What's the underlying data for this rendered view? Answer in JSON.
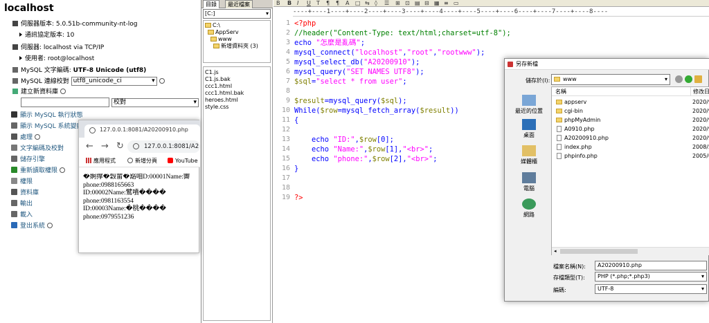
{
  "pma": {
    "host": "localhost",
    "server_version": "伺服器版本: 5.0.51b-community-nt-log",
    "protocol": "通訊協定版本: 10",
    "server": "伺服器: localhost via TCP/IP",
    "user": "使用者: root@localhost",
    "charset_label": "MySQL 文字編碼:",
    "charset_value": "UTF-8 Unicode (utf8)",
    "collation_label": "MySQL 連線校對",
    "collation_value": "utf8_unicode_ci",
    "create_db": "建立新資料庫",
    "collation_select": "校對",
    "menu": [
      "顯示 MySQL 執行狀態",
      "顯示 MySQL 系統變數",
      "處理",
      "文字編碼及校對",
      "儲存引擎",
      "重新讀取權限",
      "權限",
      "資料庫",
      "輸出",
      "載入",
      "登出系統"
    ]
  },
  "filebrowser": {
    "tabs": [
      "目錄",
      "最近檔案"
    ],
    "drive": "[C:]",
    "tree": [
      "C:\\",
      "AppServ",
      "www",
      "新增資料夾 (3)"
    ],
    "files": [
      "C1.js",
      "C1.js.bak",
      "ccc1.html",
      "ccc1.html.bak",
      "heroes.html",
      "style.css"
    ]
  },
  "editor": {
    "toolbar": [
      "B",
      "I",
      "U",
      "T",
      "¶",
      "¶",
      "A",
      "□",
      "⇆",
      "◊",
      "☰",
      "⊞",
      "⊡",
      "▤",
      "⊟",
      "▦",
      "≡",
      "▭"
    ],
    "ruler": "----+----1----+----2----+----3----+----4----+----5----+----6----+----7----+----8----",
    "lines": [
      "1",
      "2",
      "3",
      "4",
      "5",
      "6",
      "7",
      "8",
      "9",
      "10",
      "11",
      "12",
      "13",
      "14",
      "15",
      "16",
      "17",
      "18",
      "19"
    ]
  },
  "browser": {
    "tab_title": "127.0.0.1:8081/A20200910.php",
    "url": "127.0.0.1:8081/A2",
    "bookmarks": [
      "應用程式",
      "新增分頁",
      "YouTube"
    ],
    "body": [
      "�婀撑�穀畲�豁咱D:00001Name:霽",
      "phone:0988165663",
      "ID:00002Name:鷿噴����",
      "phone:0981163554",
      "ID:00003Name:�桃����",
      "phone:0979551236"
    ]
  },
  "dialog": {
    "title": "另存新檔",
    "save_in_label": "儲存於(I):",
    "save_in_value": "www",
    "places": [
      "最近的位置",
      "桌面",
      "媒體櫃",
      "電腦",
      "網路"
    ],
    "col_name": "名稱",
    "col_date": "修改日",
    "items": [
      {
        "name": "appserv",
        "date": "2020/9",
        "type": "folder"
      },
      {
        "name": "cgi-bin",
        "date": "2020/9",
        "type": "folder"
      },
      {
        "name": "phpMyAdmin",
        "date": "2020/9",
        "type": "folder"
      },
      {
        "name": "A0910.php",
        "date": "2020/9",
        "type": "file"
      },
      {
        "name": "A20200910.php",
        "date": "2020/9",
        "type": "file"
      },
      {
        "name": "index.php",
        "date": "2008/5",
        "type": "file"
      },
      {
        "name": "phpinfo.php",
        "date": "2005/6",
        "type": "file"
      }
    ],
    "filename_label": "檔案名稱(N):",
    "filename_value": "A20200910.php",
    "filetype_label": "存檔類型(T):",
    "filetype_value": "PHP (*.php;*.php3)",
    "encoding_label": "編碼:",
    "encoding_value": "UTF-8"
  }
}
